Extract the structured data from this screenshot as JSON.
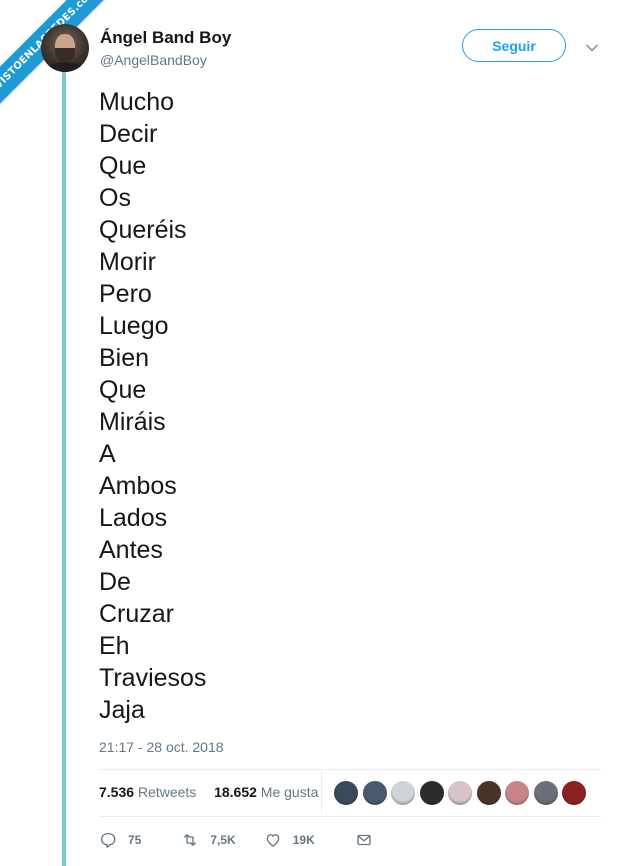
{
  "watermark": {
    "text": "VISTOENLASREDES.com"
  },
  "user": {
    "display_name": "Ángel Band Boy",
    "handle": "@AngelBandBoy"
  },
  "follow_button": {
    "label": "Seguir"
  },
  "tweet": {
    "lines": [
      "Mucho",
      "Decir",
      "Que",
      "Os",
      "Queréis",
      "Morir",
      "Pero",
      "Luego",
      "Bien",
      "Que",
      "Miráis",
      "A",
      "Ambos",
      "Lados",
      "Antes",
      "De",
      "Cruzar",
      "Eh",
      "Traviesos",
      "Jaja"
    ],
    "timestamp": "21:17 - 28 oct. 2018"
  },
  "stats": {
    "retweets_count": "7.536",
    "retweets_label": "Retweets",
    "likes_count": "18.652",
    "likes_label": "Me gusta"
  },
  "liker_avatars": [
    {
      "color": "#3b4a5a"
    },
    {
      "color": "#4a5a6e"
    },
    {
      "color": "#cfd3d6"
    },
    {
      "color": "#2b2b2b"
    },
    {
      "color": "#d9c3c8"
    },
    {
      "color": "#4a3328"
    },
    {
      "color": "#c9848a"
    },
    {
      "color": "#6a6f78"
    },
    {
      "color": "#8a2222"
    }
  ],
  "actions": {
    "replies": "75",
    "retweets": "7,5K",
    "likes": "19K"
  },
  "colors": {
    "accent": "#1da1f2",
    "secondary_text": "#657786",
    "frame_line": "#7fc8d8",
    "banner": "#1e9ad6"
  }
}
